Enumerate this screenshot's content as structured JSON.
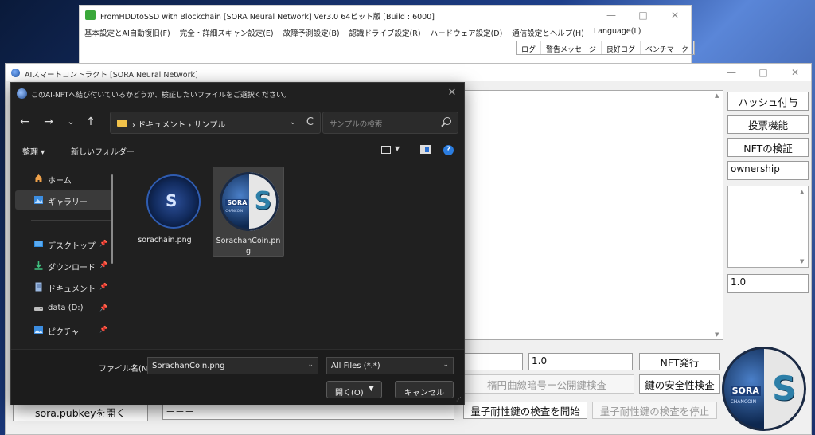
{
  "main_window": {
    "title": "FromHDDtoSSD with Blockchain [SORA Neural Network] Ver3.0 64ビット版 [Build : 6000]",
    "menu": [
      "基本設定とAI自動復旧(F)",
      "完全・詳細スキャン設定(E)",
      "故障予測設定(B)",
      "認識ドライブ設定(R)",
      "ハードウェア設定(D)",
      "通信設定とヘルプ(H)",
      "Language(L)"
    ],
    "log_tabs": [
      "ログ",
      "警告メッセージ",
      "良好ログ",
      "ベンチマーク"
    ]
  },
  "window_controls": {
    "minimize": "—",
    "maximize": "□",
    "close": "✕"
  },
  "ai_window": {
    "title": "AIスマートコントラクト [SORA Neural Network]",
    "buttons": {
      "hash": "ハッシュ付与",
      "vote": "投票機能",
      "nft_verify": "NFTの検証",
      "nft_issue": "NFT発行",
      "ecc_check": "楕円曲線暗号ー公開鍵検査",
      "key_safety": "鍵の安全性検査",
      "pq_start": "量子耐性鍵の検査を開始",
      "pq_stop": "量子耐性鍵の検査を停止",
      "open_pubkey": "sora.pubkeyを開く"
    },
    "fields": {
      "ownership": "ownership",
      "side_value": "1.0",
      "bottom_value": "1.0",
      "status_text": "－－－"
    },
    "logo": {
      "sora": "SORA",
      "chancoin": "CHANCOIN"
    }
  },
  "file_dialog": {
    "title": "このAI-NFTへ結び付いているかどうか、検証したいファイルをご選択ください。",
    "close": "✕",
    "nav": {
      "back": "←",
      "forward": "→",
      "recent": "⌄",
      "up": "↑",
      "refresh": "C"
    },
    "address": "› ドキュメント › サンプル",
    "search_placeholder": "サンプルの検索",
    "toolbar": {
      "organize": "整理 ▾",
      "new_folder": "新しいフォルダー",
      "help": "?"
    },
    "nav_pane": [
      {
        "label": "ホーム",
        "icon": "home-icon"
      },
      {
        "label": "ギャラリー",
        "icon": "gallery-icon"
      },
      {
        "label": "デスクトップ",
        "icon": "desktop-icon"
      },
      {
        "label": "ダウンロード",
        "icon": "download-icon"
      },
      {
        "label": "ドキュメント",
        "icon": "documents-icon"
      },
      {
        "label": "data (D:)",
        "icon": "drive-icon"
      },
      {
        "label": "ピクチャ",
        "icon": "pictures-icon"
      }
    ],
    "pin_glyph": "📌",
    "files": [
      {
        "name": "sorachain.png"
      },
      {
        "name": "SorachanCoin.png"
      }
    ],
    "thumb_glyph": "S",
    "filename_label": "ファイル名(N):",
    "filename_value": "SorachanCoin.png",
    "filetype": "All Files (*.*)",
    "open": "開く(O)",
    "cancel": "キャンセル"
  }
}
